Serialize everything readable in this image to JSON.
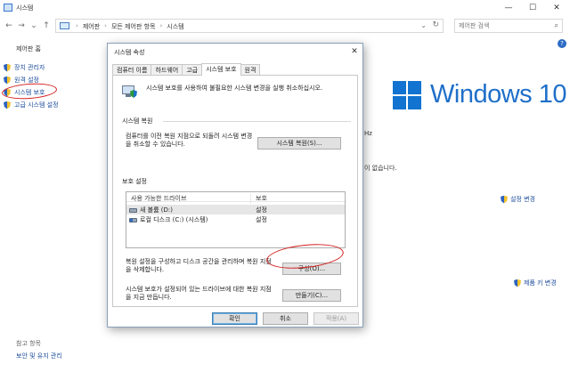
{
  "window": {
    "title": "시스템",
    "minimize": "—",
    "maximize": "☐",
    "close": "✕"
  },
  "nav": {
    "back": "←",
    "forward": "→",
    "recent": "⌄",
    "up": "↑"
  },
  "address": {
    "crumbs": [
      "제어판",
      "모든 제어판 항목",
      "시스템"
    ],
    "separator": "›",
    "dropdown": "⌄",
    "refresh": "↻"
  },
  "search": {
    "placeholder": "제어판 검색",
    "icon": "search-icon"
  },
  "help": "?",
  "sidebar": {
    "home": "제어판 홈",
    "items": [
      {
        "label": "장치 관리자",
        "icon": "shield-icon"
      },
      {
        "label": "원격 설정",
        "icon": "shield-icon"
      },
      {
        "label": "시스템 보호",
        "icon": "shield-icon"
      },
      {
        "label": "고급 시스템 설정",
        "icon": "shield-icon"
      }
    ],
    "see_also": "참고 항목",
    "bottom_link": "보안 및 유지 관리"
  },
  "background": {
    "brand": "Windows 10",
    "hz_fragment": "Hz",
    "unavailable_fragment": "이 없습니다.",
    "change_settings": "설정 변경",
    "product_key": "제품 키 변경"
  },
  "dialog": {
    "title": "시스템 속성",
    "close": "✕",
    "tabs": [
      {
        "label": "컴퓨터 이름",
        "active": false
      },
      {
        "label": "하드웨어",
        "active": false
      },
      {
        "label": "고급",
        "active": false
      },
      {
        "label": "시스템 보호",
        "active": true
      },
      {
        "label": "원격",
        "active": false
      }
    ],
    "description": "시스템 보호를 사용하여 불필요한 시스템 변경을 실행 취소하십시오.",
    "restore_group": "시스템 복원",
    "restore_text": "컴퓨터를 이전 복원 지점으로 되돌려 시스템 변경을 취소할 수 있습니다.",
    "restore_button": "시스템 복원(S)...",
    "protection_group": "보호 설정",
    "table_headers": [
      "사용 가능한 드라이브",
      "보호"
    ],
    "drives": [
      {
        "name": "새 볼륨 (D:)",
        "protection": "설정",
        "icon": "drive-icon",
        "selected": true
      },
      {
        "name": "로컬 디스크 (C:) (시스템)",
        "protection": "설정",
        "icon": "system-drive-icon",
        "selected": false
      }
    ],
    "configure_text": "복원 설정을 구성하고 디스크 공간을 관리하며 복원 지점을 삭제합니다.",
    "configure_button": "구성(O)...",
    "create_text": "시스템 보호가 설정되어 있는 드라이브에 대한 복원 지점을 지금 만듭니다.",
    "create_button": "만들기(C)...",
    "ok": "확인",
    "cancel": "취소",
    "apply": "적용(A)"
  },
  "colors": {
    "link": "#1a4b9a",
    "windows_blue": "#1273d0",
    "annotation_red": "#d62020"
  }
}
